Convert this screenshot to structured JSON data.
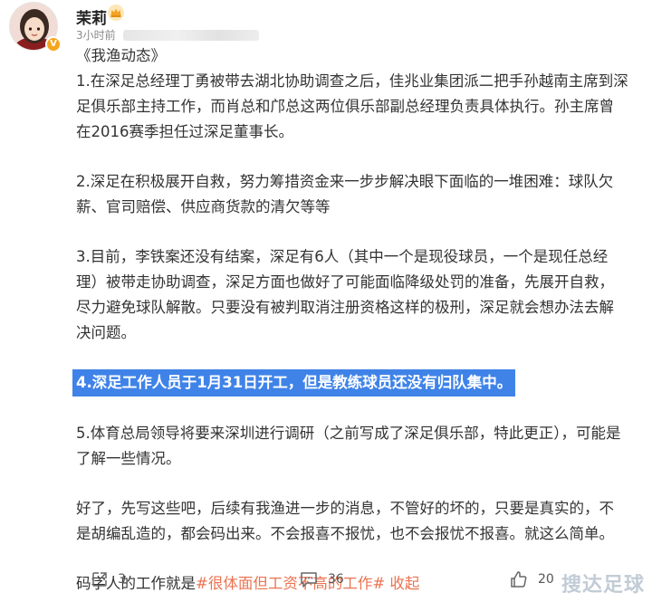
{
  "header": {
    "username": "茉莉",
    "time_text": "3小时前"
  },
  "post": {
    "title": "《我渔动态》",
    "paragraphs": [
      "1.在深足总经理丁勇被带去湖北协助调查之后，佳兆业集团派二把手孙越南主席到深足俱乐部主持工作，而肖总和邝总这两位俱乐部副总经理负责具体执行。孙主席曾在2016赛季担任过深足董事长。",
      "2.深足在积极展开自救，努力筹措资金来一步步解决眼下面临的一堆困难：球队欠薪、官司赔偿、供应商货款的清欠等等",
      "3.目前，李铁案还没有结案，深足有6人（其中一个是现役球员，一个是现任总经理）被带走协助调查，深足方面也做好了可能面临降级处罚的准备，先展开自救，尽力避免球队解散。只要没有被判取消注册资格这样的极刑，深足就会想办法去解决问题。",
      "4.深足工作人员于1月31日开工，但是教练球员还没有归队集中。",
      "5.体育总局领导将要来深圳进行调研（之前写成了深足俱乐部，特此更正），可能是了解一些情况。",
      "好了，先写这些吧，后续有我渔进一步的消息，不管好的坏的，只要是真实的，不是胡编乱造的，都会码出来。不会报喜不报忧，也不会报忧不报喜。就这么简单。"
    ],
    "closing_prefix": "码字人的工作就是",
    "topic_tag": "#很体面但工资不高的工作#",
    "collapse_label": "收起"
  },
  "actions": {
    "repost_count": "3",
    "comment_count": "36",
    "like_count": "20"
  },
  "watermark": "搜达足球",
  "colors": {
    "highlight": "#3f83e8",
    "topic": "#eb7350",
    "vip_badge": "#f7a51c"
  },
  "icons": {
    "repost": "share-out-icon",
    "comment": "comment-bubble-icon",
    "like": "thumbs-up-icon",
    "badge": "crown-icon"
  }
}
